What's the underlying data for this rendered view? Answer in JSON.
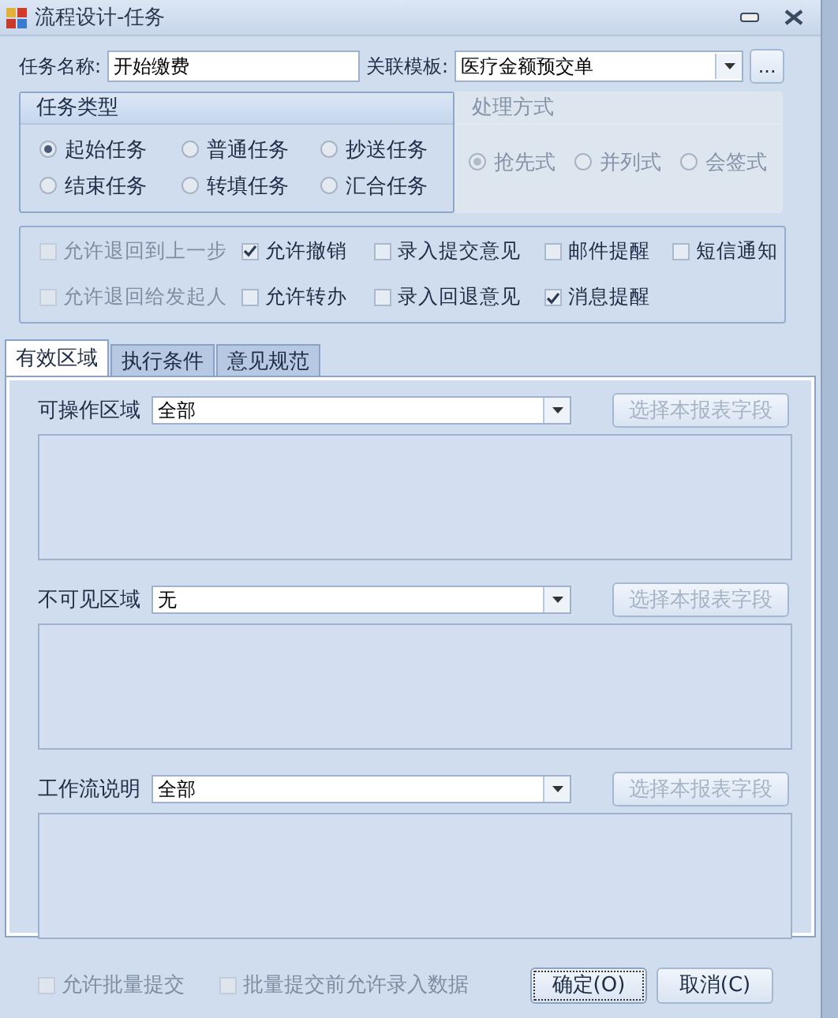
{
  "window": {
    "title": "流程设计-任务"
  },
  "task_name": {
    "label": "任务名称:",
    "value": "开始缴费"
  },
  "template": {
    "label": "关联模板:",
    "value": "医疗金额预交单",
    "browse": "..."
  },
  "task_type": {
    "title": "任务类型",
    "disabled": false,
    "options": [
      {
        "label": "起始任务",
        "selected": true
      },
      {
        "label": "普通任务",
        "selected": false
      },
      {
        "label": "抄送任务",
        "selected": false
      },
      {
        "label": "结束任务",
        "selected": false
      },
      {
        "label": "转填任务",
        "selected": false
      },
      {
        "label": "汇合任务",
        "selected": false
      }
    ]
  },
  "handling": {
    "title": "处理方式",
    "disabled": true,
    "options": [
      {
        "label": "抢先式",
        "selected": true
      },
      {
        "label": "并列式",
        "selected": false
      },
      {
        "label": "会签式",
        "selected": false
      }
    ]
  },
  "options": [
    {
      "label": "允许退回到上一步",
      "checked": false,
      "disabled": true
    },
    {
      "label": "允许撤销",
      "checked": true,
      "disabled": false
    },
    {
      "label": "录入提交意见",
      "checked": false,
      "disabled": false
    },
    {
      "label": "邮件提醒",
      "checked": false,
      "disabled": false
    },
    {
      "label": "短信通知",
      "checked": false,
      "disabled": false
    },
    {
      "label": "允许退回给发起人",
      "checked": false,
      "disabled": true
    },
    {
      "label": "允许转办",
      "checked": false,
      "disabled": false
    },
    {
      "label": "录入回退意见",
      "checked": false,
      "disabled": false
    },
    {
      "label": "消息提醒",
      "checked": true,
      "disabled": false
    }
  ],
  "tabs": [
    {
      "label": "有效区域",
      "selected": true
    },
    {
      "label": "执行条件",
      "selected": false
    },
    {
      "label": "意见规范",
      "selected": false
    }
  ],
  "regions": [
    {
      "label": "可操作区域",
      "value": "全部",
      "button": "选择本报表字段",
      "button_disabled": true
    },
    {
      "label": "不可见区域",
      "value": "无",
      "button": "选择本报表字段",
      "button_disabled": true
    },
    {
      "label": "工作流说明",
      "value": "全部",
      "button": "选择本报表字段",
      "button_disabled": true
    }
  ],
  "footer_options": [
    {
      "label": "允许批量提交",
      "checked": false,
      "disabled": true
    },
    {
      "label": "批量提交前允许录入数据",
      "checked": false,
      "disabled": true
    }
  ],
  "buttons": [
    {
      "label": "确定(O)",
      "default": true
    },
    {
      "label": "取消(C)",
      "default": false
    }
  ]
}
